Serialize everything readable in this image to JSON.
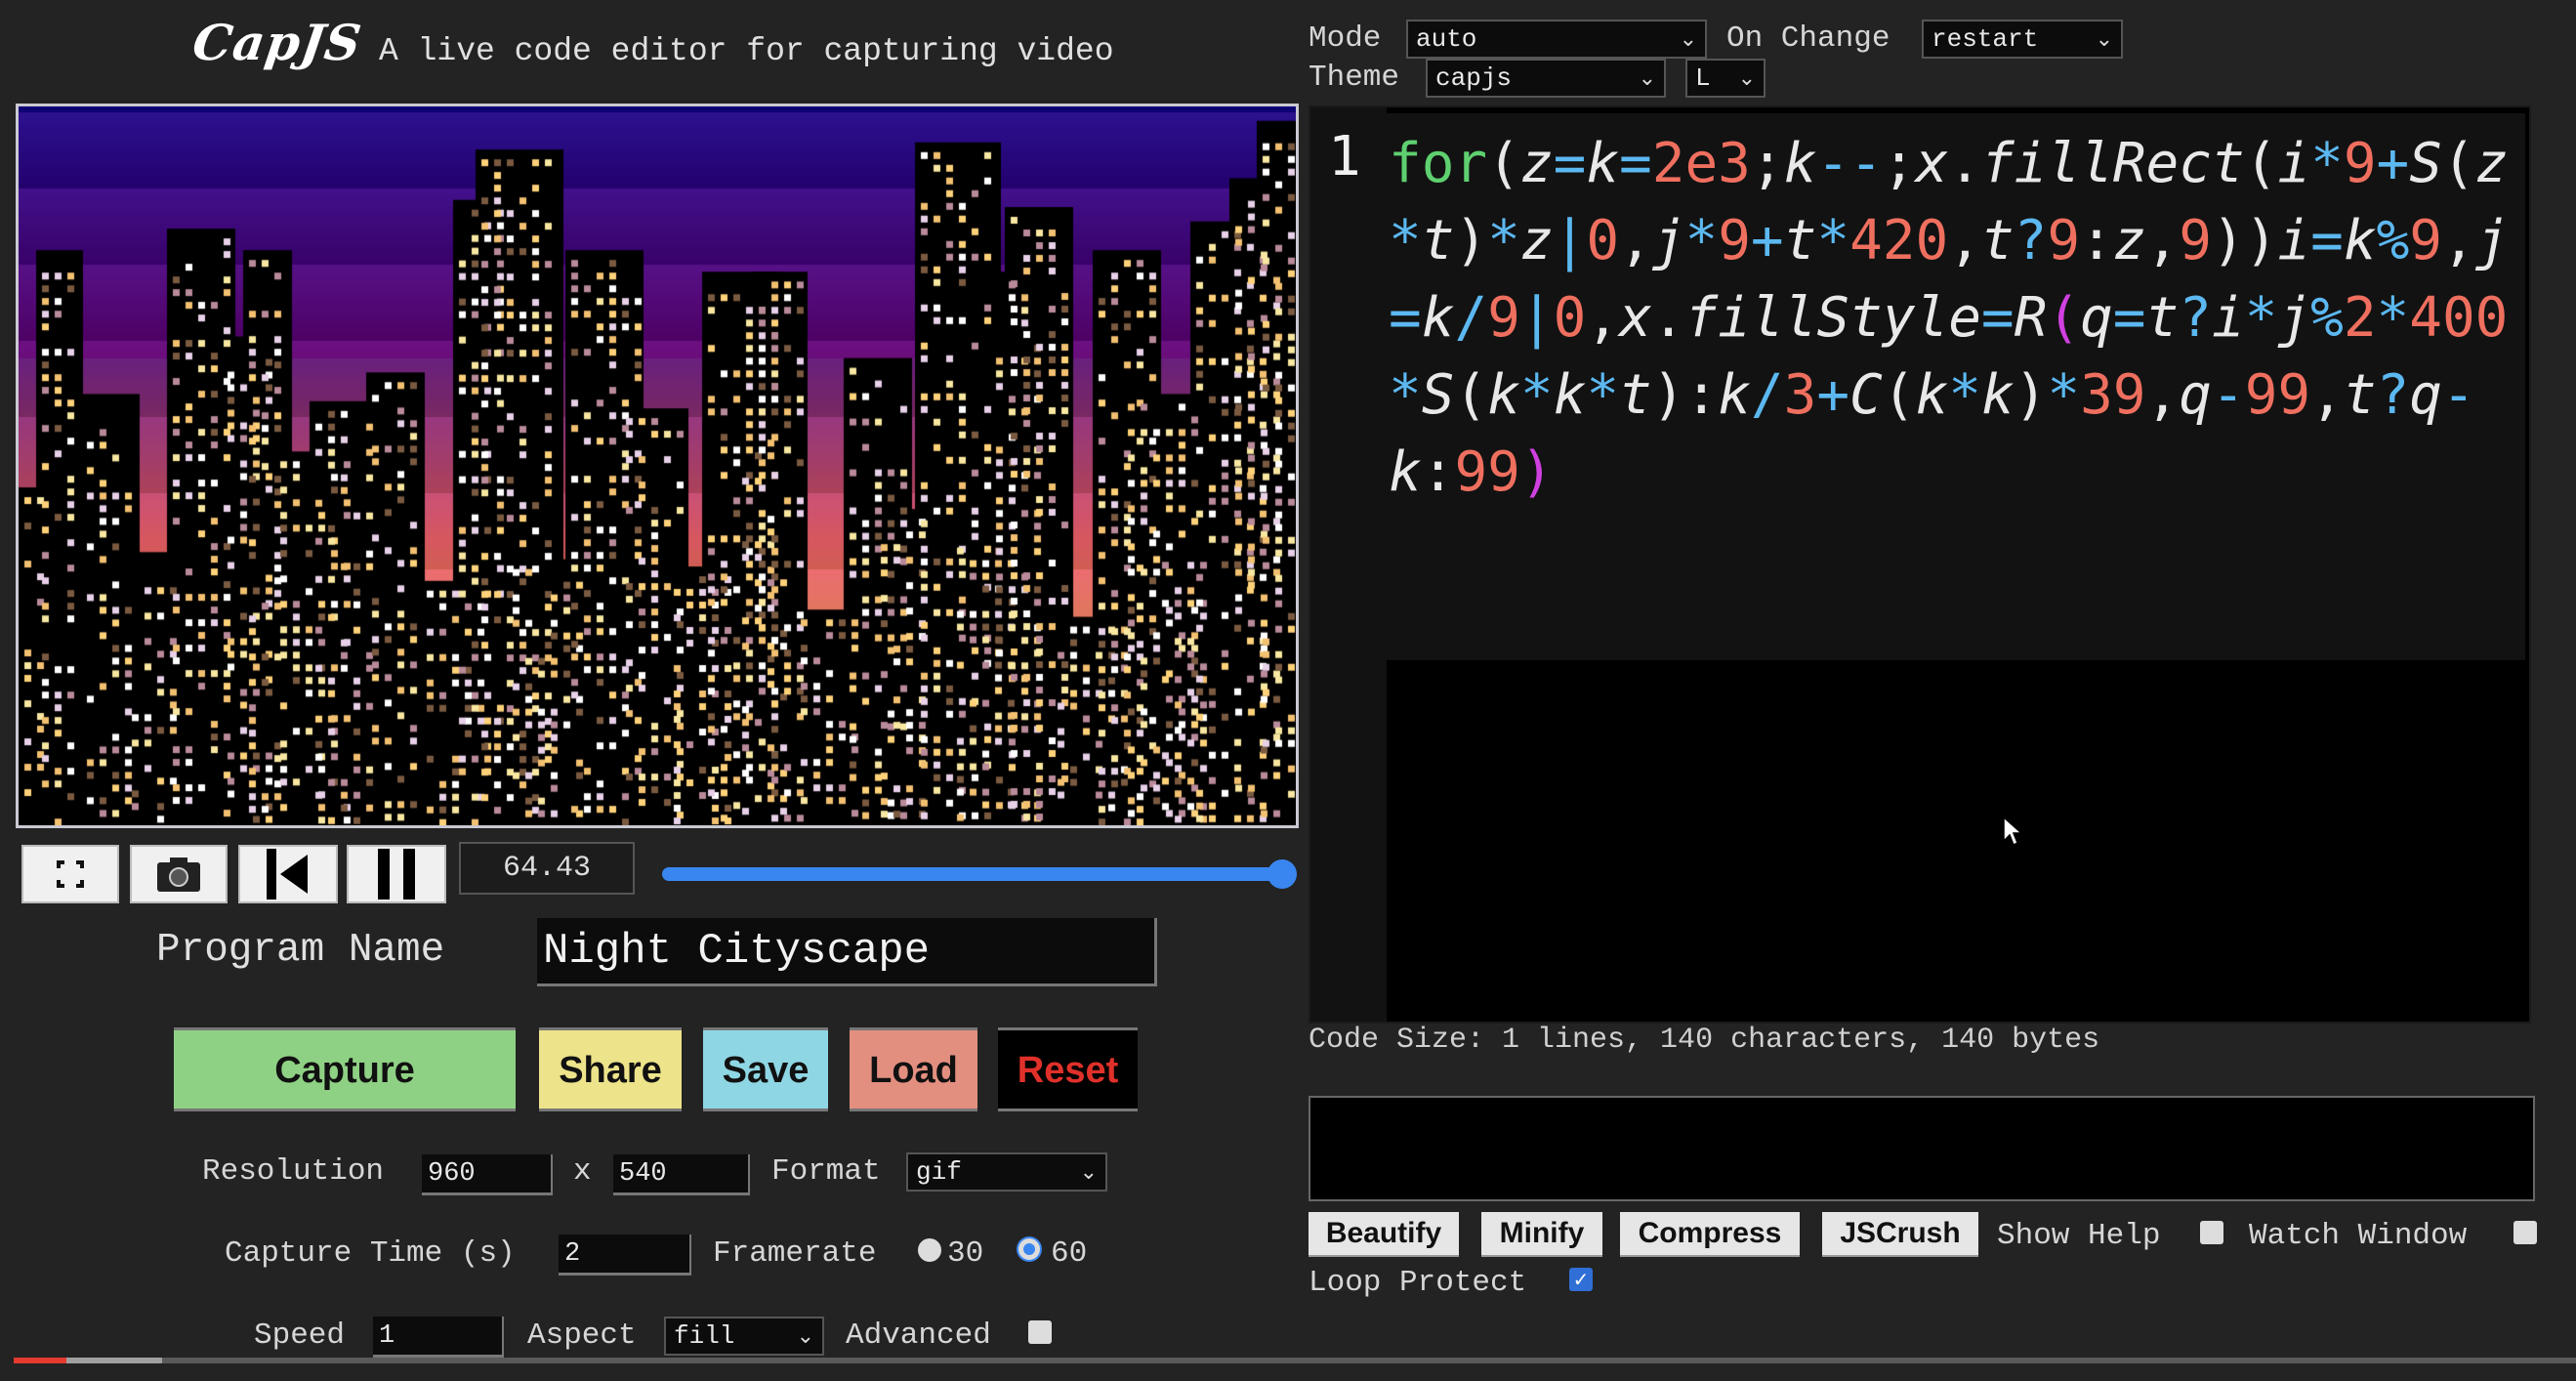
{
  "header": {
    "logo": "CapJS",
    "tagline": "A live code editor for capturing video"
  },
  "preview": {
    "time_value": "64.43",
    "timeline_progress_percent": 100,
    "controls": [
      {
        "name": "fullscreen",
        "icon": "fullscreen-icon"
      },
      {
        "name": "screenshot",
        "icon": "camera-icon"
      },
      {
        "name": "restart",
        "icon": "skip-back-icon"
      },
      {
        "name": "pause",
        "icon": "pause-icon"
      }
    ],
    "accent_color": "#3a86f0"
  },
  "program": {
    "label": "Program Name",
    "value": "Night Cityscape"
  },
  "actions": {
    "capture": {
      "label": "Capture",
      "color": "#8fd184"
    },
    "share": {
      "label": "Share",
      "color": "#ece38a"
    },
    "save": {
      "label": "Save",
      "color": "#8fd6e4"
    },
    "load": {
      "label": "Load",
      "color": "#e38f80"
    },
    "reset": {
      "label": "Reset",
      "color": "#000000",
      "text_color": "#e0302a"
    }
  },
  "settings": {
    "resolution_label": "Resolution",
    "width": "960",
    "x_label": "x",
    "height": "540",
    "format_label": "Format",
    "format_value": "gif",
    "capture_time_label": "Capture Time (s)",
    "capture_time": "2",
    "framerate_label": "Framerate",
    "framerate_options": [
      "30",
      "60"
    ],
    "framerate_selected": "60",
    "speed_label": "Speed",
    "speed": "1",
    "aspect_label": "Aspect",
    "aspect_value": "fill",
    "advanced_label": "Advanced",
    "advanced_checked": false
  },
  "editor_settings": {
    "mode_label": "Mode",
    "mode_value": "auto",
    "on_change_label": "On Change",
    "on_change_value": "restart",
    "theme_label": "Theme",
    "theme_value": "capjs",
    "size_value": "L"
  },
  "editor": {
    "line_number": "1",
    "code": "for(z=k=2e3;k--;x.fillRect(i*9+S(z*t)*z|0,j*9+t*420,t?9:z,9))i=k%9,j=k/9|0,x.fillStyle=R(q=t?i*j%2*400*S(k*k*t):k/3+C(k*k)*39,q-99,t?q-k:99)",
    "code_size": "Code Size: 1 lines, 140 characters, 140 bytes"
  },
  "tools": {
    "beautify": "Beautify",
    "minify": "Minify",
    "compress": "Compress",
    "jscrush": "JSCrush",
    "show_help_label": "Show Help",
    "show_help_checked": false,
    "watch_window_label": "Watch Window",
    "watch_window_checked": false,
    "loop_protect_label": "Loop Protect",
    "loop_protect_checked": true
  }
}
